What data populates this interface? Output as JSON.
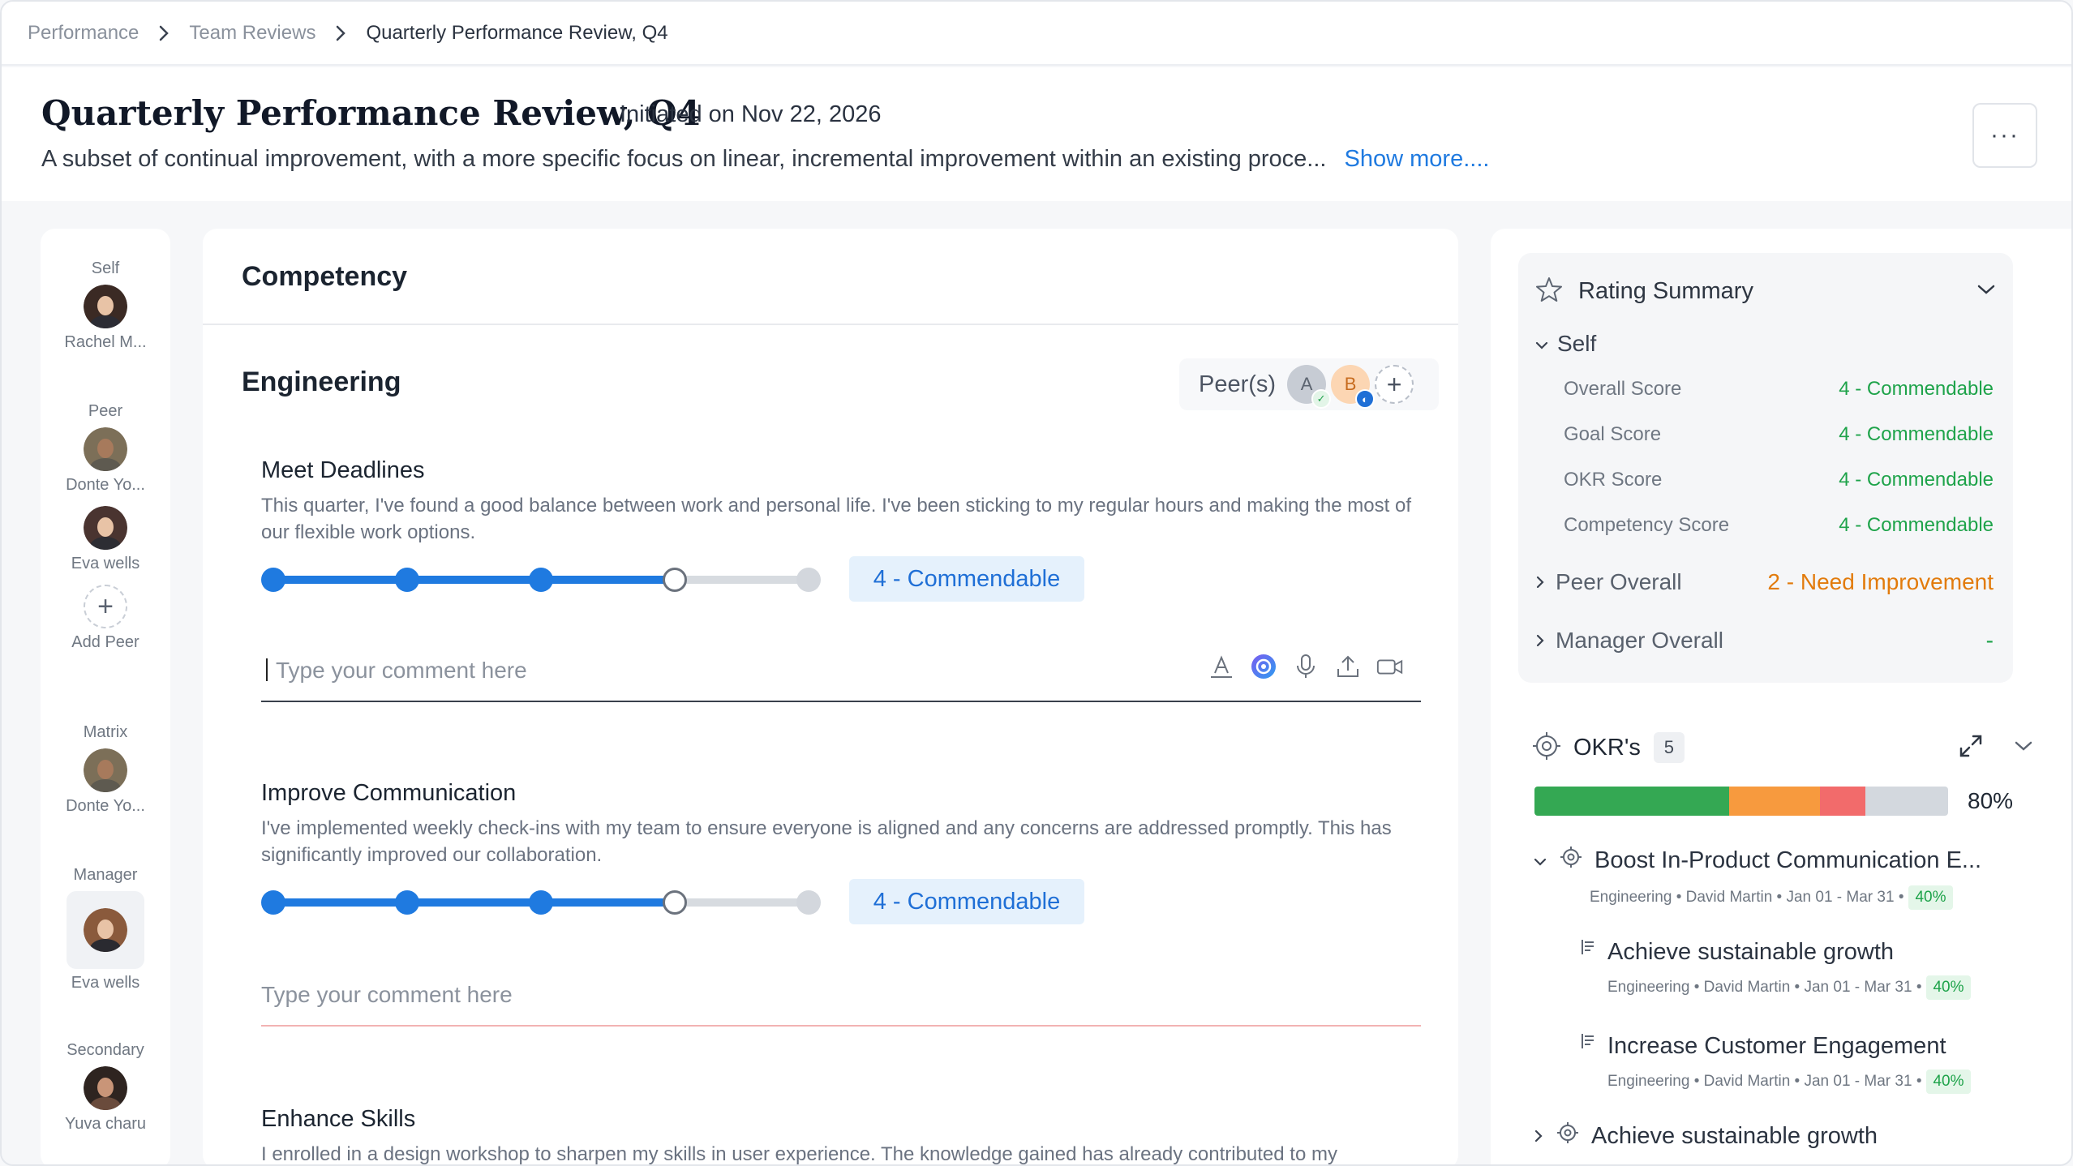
{
  "breadcrumb": {
    "items": [
      "Performance",
      "Team Reviews",
      "Quarterly Performance Review, Q4"
    ]
  },
  "header": {
    "title": "Quarterly Performance Review, Q4",
    "initiated": "Initiated on Nov 22, 2026",
    "description": "A subset of continual improvement, with a more specific focus on linear, incremental improvement within an existing proce...",
    "show_more": "Show more....",
    "more_button": "···"
  },
  "rail": {
    "self_label": "Self",
    "self_name": "Rachel M...",
    "peer_label": "Peer",
    "peer1_name": "Donte Yo...",
    "peer2_name": "Eva wells",
    "add_peer": "Add Peer",
    "matrix_label": "Matrix",
    "matrix_name": "Donte Yo...",
    "manager_label": "Manager",
    "manager_name": "Eva wells",
    "secondary_label": "Secondary",
    "secondary_name": "Yuva charu"
  },
  "main": {
    "title": "Competency",
    "section": "Engineering",
    "peers_label": "Peer(s)",
    "peer_chips": [
      "A",
      "B"
    ],
    "competencies": [
      {
        "title": "Meet Deadlines",
        "description": "This quarter, I've found a good balance between work and personal life. I've been sticking to my regular hours and making the most of our flexible work options.",
        "rating_level": 4,
        "rating_max": 5,
        "rating_label": "4 - Commendable",
        "comment_placeholder": "Type your comment here"
      },
      {
        "title": "Improve Communication",
        "description": "I've implemented weekly check-ins with my team to ensure everyone is aligned and any concerns are addressed promptly. This has significantly improved our collaboration.",
        "rating_level": 4,
        "rating_max": 5,
        "rating_label": "4 - Commendable",
        "comment_placeholder": "Type your comment here"
      },
      {
        "title": "Enhance Skills",
        "description": "I enrolled in a design workshop to sharpen my skills in user experience. The knowledge gained has already contributed to my"
      }
    ]
  },
  "summary": {
    "title": "Rating Summary",
    "self_label": "Self",
    "scores": [
      {
        "label": "Overall Score",
        "value": "4 - Commendable"
      },
      {
        "label": "Goal Score",
        "value": "4 - Commendable"
      },
      {
        "label": "OKR Score",
        "value": "4 - Commendable"
      },
      {
        "label": "Competency Score",
        "value": "4 - Commendable"
      }
    ],
    "peer_overall_label": "Peer Overall",
    "peer_overall_value": "2 - Need Improvement",
    "manager_overall_label": "Manager Overall",
    "manager_overall_value": "-"
  },
  "okrs": {
    "title": "OKR's",
    "count": "5",
    "overall_pct": "80%",
    "segments": [
      {
        "fraction": 0.47,
        "color": "#34a853"
      },
      {
        "fraction": 0.22,
        "color": "#f79a3e"
      },
      {
        "fraction": 0.11,
        "color": "#f26b6b"
      },
      {
        "fraction": 0.2,
        "color": "#d3d8de"
      }
    ],
    "items": [
      {
        "title": "Boost In-Product Communication E...",
        "meta": "Engineering • David Martin • Jan 01 - Mar 31 •",
        "pct": "40%"
      },
      {
        "title": "Achieve sustainable growth",
        "meta": "Engineering • David Martin • Jan 01 - Mar 31 •",
        "pct": "40%"
      },
      {
        "title": "Increase Customer Engagement",
        "meta": "Engineering • David Martin • Jan 01 - Mar 31 •",
        "pct": "40%"
      },
      {
        "title": "Achieve sustainable growth"
      }
    ]
  }
}
